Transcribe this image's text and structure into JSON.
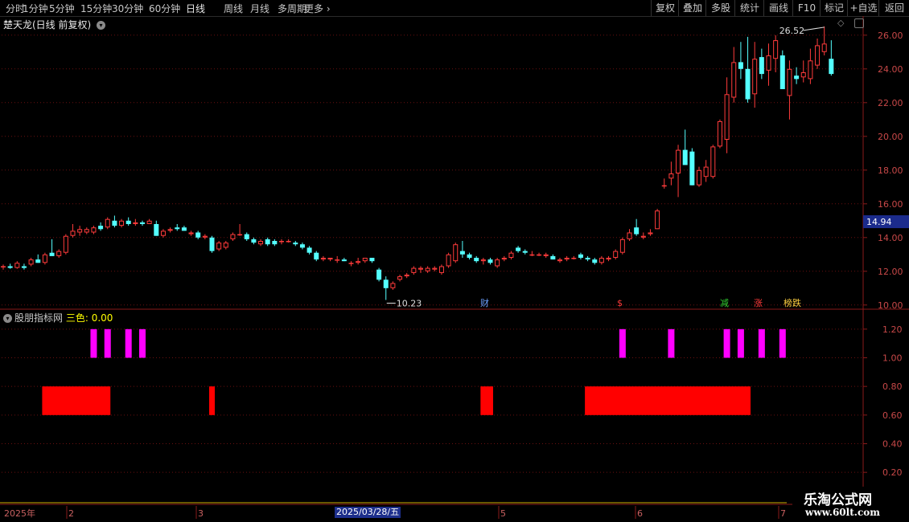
{
  "toolbar": {
    "periods": [
      "分时",
      "1分钟",
      "5分钟",
      "15分钟",
      "30分钟",
      "60分钟",
      "日线",
      "周线",
      "月线",
      "多周期",
      "更多"
    ],
    "active": "日线",
    "right_buttons": [
      "复权",
      "叠加",
      "多股",
      "统计",
      "画线",
      "F10",
      "标记",
      "+自选",
      "返回"
    ]
  },
  "main_panel": {
    "title": "楚天龙(日线 前复权)",
    "high_label": "26.52",
    "low_label": "10.23",
    "current_price": "14.94",
    "y_ticks": [
      "26.00",
      "24.00",
      "22.00",
      "20.00",
      "18.00",
      "16.00",
      "14.00",
      "12.00",
      "10.00"
    ],
    "signals": [
      {
        "text": "财",
        "color": "#6aa0ff"
      },
      {
        "text": "$",
        "color": "#ff3a3a"
      },
      {
        "text": "减",
        "color": "#30d030"
      },
      {
        "text": "涨",
        "color": "#ff3a3a"
      },
      {
        "text": "榜跌",
        "color": "#ffd040"
      }
    ]
  },
  "indicator_panel": {
    "name": "股朋指标网",
    "label": "三色:",
    "value": "0.00",
    "y_ticks": [
      "1.20",
      "1.00",
      "0.80",
      "0.60",
      "0.40",
      "0.20"
    ]
  },
  "x_axis": {
    "year": "2025年",
    "labels": [
      "2",
      "3",
      "5",
      "6",
      "7"
    ],
    "cursor_date": "2025/03/28/五"
  },
  "watermark": {
    "line1": "乐淘公式网",
    "line2": "www.60lt.com"
  },
  "colors": {
    "up": "#ff3b3b",
    "down": "#54ffff",
    "magenta": "#ff00ff",
    "red_block": "#ff0000",
    "grid": "#6a1010"
  },
  "chart_data": [
    {
      "type": "candlestick",
      "ylim": [
        9.8,
        26.8
      ],
      "candles": [
        {
          "o": 12.25,
          "h": 12.4,
          "l": 12.1,
          "c": 12.3
        },
        {
          "o": 12.3,
          "h": 12.45,
          "l": 12.15,
          "c": 12.2
        },
        {
          "o": 12.2,
          "h": 12.6,
          "l": 12.15,
          "c": 12.5
        },
        {
          "o": 12.3,
          "h": 12.45,
          "l": 12.1,
          "c": 12.2
        },
        {
          "o": 12.4,
          "h": 12.8,
          "l": 12.3,
          "c": 12.7
        },
        {
          "o": 12.7,
          "h": 13.0,
          "l": 12.5,
          "c": 12.5
        },
        {
          "o": 12.5,
          "h": 13.1,
          "l": 12.4,
          "c": 13.0
        },
        {
          "o": 13.1,
          "h": 13.9,
          "l": 13.0,
          "c": 12.9
        },
        {
          "o": 12.9,
          "h": 13.3,
          "l": 12.8,
          "c": 13.2
        },
        {
          "o": 13.1,
          "h": 14.2,
          "l": 13.0,
          "c": 14.1
        },
        {
          "o": 14.1,
          "h": 14.8,
          "l": 14.0,
          "c": 14.4
        },
        {
          "o": 14.3,
          "h": 14.7,
          "l": 14.1,
          "c": 14.5
        },
        {
          "o": 14.3,
          "h": 14.6,
          "l": 14.2,
          "c": 14.5
        },
        {
          "o": 14.3,
          "h": 14.7,
          "l": 14.2,
          "c": 14.6
        },
        {
          "o": 14.7,
          "h": 14.9,
          "l": 14.4,
          "c": 14.5
        },
        {
          "o": 14.6,
          "h": 15.2,
          "l": 14.5,
          "c": 15.1
        },
        {
          "o": 15.0,
          "h": 15.3,
          "l": 14.6,
          "c": 14.7
        },
        {
          "o": 14.7,
          "h": 15.1,
          "l": 14.6,
          "c": 15.0
        },
        {
          "o": 15.0,
          "h": 15.2,
          "l": 14.7,
          "c": 14.8
        },
        {
          "o": 14.8,
          "h": 15.1,
          "l": 14.7,
          "c": 14.9
        },
        {
          "o": 14.9,
          "h": 15.0,
          "l": 14.7,
          "c": 14.8
        },
        {
          "o": 14.8,
          "h": 15.1,
          "l": 14.8,
          "c": 15.0
        },
        {
          "o": 14.8,
          "h": 15.0,
          "l": 14.1,
          "c": 14.1
        },
        {
          "o": 14.1,
          "h": 14.5,
          "l": 14.0,
          "c": 14.4
        },
        {
          "o": 14.4,
          "h": 14.6,
          "l": 14.3,
          "c": 14.5
        },
        {
          "o": 14.6,
          "h": 14.8,
          "l": 14.4,
          "c": 14.5
        },
        {
          "o": 14.6,
          "h": 14.7,
          "l": 14.4,
          "c": 14.4
        },
        {
          "o": 14.2,
          "h": 14.4,
          "l": 14.1,
          "c": 14.3
        },
        {
          "o": 14.3,
          "h": 14.4,
          "l": 13.9,
          "c": 14.0
        },
        {
          "o": 14.0,
          "h": 14.2,
          "l": 13.9,
          "c": 14.1
        },
        {
          "o": 14.0,
          "h": 14.1,
          "l": 13.1,
          "c": 13.2
        },
        {
          "o": 13.3,
          "h": 13.8,
          "l": 13.2,
          "c": 13.7
        },
        {
          "o": 13.4,
          "h": 13.8,
          "l": 13.3,
          "c": 13.7
        },
        {
          "o": 13.9,
          "h": 14.3,
          "l": 13.8,
          "c": 14.2
        },
        {
          "o": 14.2,
          "h": 14.8,
          "l": 14.1,
          "c": 14.2
        },
        {
          "o": 14.2,
          "h": 14.3,
          "l": 13.8,
          "c": 13.9
        },
        {
          "o": 13.9,
          "h": 14.0,
          "l": 13.6,
          "c": 13.7
        },
        {
          "o": 13.6,
          "h": 13.9,
          "l": 13.5,
          "c": 13.8
        },
        {
          "o": 13.9,
          "h": 14.0,
          "l": 13.5,
          "c": 13.6
        },
        {
          "o": 13.8,
          "h": 13.9,
          "l": 13.5,
          "c": 13.6
        },
        {
          "o": 13.8,
          "h": 13.9,
          "l": 13.6,
          "c": 13.8
        },
        {
          "o": 13.8,
          "h": 13.9,
          "l": 13.7,
          "c": 13.8
        },
        {
          "o": 13.7,
          "h": 13.8,
          "l": 13.5,
          "c": 13.6
        },
        {
          "o": 13.6,
          "h": 13.7,
          "l": 13.3,
          "c": 13.4
        },
        {
          "o": 13.4,
          "h": 13.5,
          "l": 13.0,
          "c": 13.1
        },
        {
          "o": 13.1,
          "h": 13.2,
          "l": 12.6,
          "c": 12.7
        },
        {
          "o": 12.7,
          "h": 12.9,
          "l": 12.6,
          "c": 12.8
        },
        {
          "o": 12.7,
          "h": 12.8,
          "l": 12.6,
          "c": 12.8
        },
        {
          "o": 12.7,
          "h": 12.9,
          "l": 12.5,
          "c": 12.7
        },
        {
          "o": 12.7,
          "h": 12.8,
          "l": 12.6,
          "c": 12.6
        },
        {
          "o": 12.5,
          "h": 12.6,
          "l": 12.3,
          "c": 12.5
        },
        {
          "o": 12.5,
          "h": 12.8,
          "l": 12.4,
          "c": 12.6
        },
        {
          "o": 12.6,
          "h": 12.8,
          "l": 12.5,
          "c": 12.8
        },
        {
          "o": 12.8,
          "h": 12.8,
          "l": 12.5,
          "c": 12.6
        },
        {
          "o": 12.1,
          "h": 12.2,
          "l": 11.4,
          "c": 11.5
        },
        {
          "o": 11.5,
          "h": 11.7,
          "l": 10.3,
          "c": 11.0
        },
        {
          "o": 11.0,
          "h": 11.4,
          "l": 10.9,
          "c": 11.3
        },
        {
          "o": 11.5,
          "h": 11.8,
          "l": 11.4,
          "c": 11.7
        },
        {
          "o": 11.7,
          "h": 11.9,
          "l": 11.6,
          "c": 11.8
        },
        {
          "o": 11.9,
          "h": 12.3,
          "l": 11.8,
          "c": 12.2
        },
        {
          "o": 12.1,
          "h": 12.3,
          "l": 11.9,
          "c": 12.2
        },
        {
          "o": 12.0,
          "h": 12.3,
          "l": 11.9,
          "c": 12.2
        },
        {
          "o": 12.1,
          "h": 12.3,
          "l": 12.0,
          "c": 12.2
        },
        {
          "o": 11.9,
          "h": 12.4,
          "l": 11.8,
          "c": 12.3
        },
        {
          "o": 12.3,
          "h": 13.1,
          "l": 12.2,
          "c": 13.0
        },
        {
          "o": 12.6,
          "h": 13.7,
          "l": 12.5,
          "c": 13.6
        },
        {
          "o": 13.2,
          "h": 13.8,
          "l": 12.8,
          "c": 13.0
        },
        {
          "o": 13.0,
          "h": 13.1,
          "l": 12.7,
          "c": 12.8
        },
        {
          "o": 12.8,
          "h": 12.9,
          "l": 12.5,
          "c": 12.6
        },
        {
          "o": 12.6,
          "h": 12.8,
          "l": 12.4,
          "c": 12.7
        },
        {
          "o": 12.7,
          "h": 12.8,
          "l": 12.4,
          "c": 12.5
        },
        {
          "o": 12.3,
          "h": 12.8,
          "l": 12.2,
          "c": 12.7
        },
        {
          "o": 12.7,
          "h": 12.9,
          "l": 12.6,
          "c": 12.8
        },
        {
          "o": 12.8,
          "h": 13.2,
          "l": 12.7,
          "c": 13.1
        },
        {
          "o": 13.4,
          "h": 13.5,
          "l": 13.1,
          "c": 13.2
        },
        {
          "o": 13.2,
          "h": 13.3,
          "l": 13.0,
          "c": 13.1
        },
        {
          "o": 13.0,
          "h": 13.2,
          "l": 12.9,
          "c": 13.0
        },
        {
          "o": 13.0,
          "h": 13.1,
          "l": 12.9,
          "c": 13.0
        },
        {
          "o": 12.9,
          "h": 13.1,
          "l": 12.8,
          "c": 13.0
        },
        {
          "o": 12.9,
          "h": 13.0,
          "l": 12.7,
          "c": 12.7
        },
        {
          "o": 12.6,
          "h": 12.8,
          "l": 12.5,
          "c": 12.7
        },
        {
          "o": 12.7,
          "h": 12.9,
          "l": 12.6,
          "c": 12.8
        },
        {
          "o": 12.8,
          "h": 12.9,
          "l": 12.7,
          "c": 12.8
        },
        {
          "o": 13.0,
          "h": 13.1,
          "l": 12.7,
          "c": 12.8
        },
        {
          "o": 12.8,
          "h": 12.9,
          "l": 12.6,
          "c": 12.7
        },
        {
          "o": 12.7,
          "h": 12.8,
          "l": 12.4,
          "c": 12.5
        },
        {
          "o": 12.5,
          "h": 12.9,
          "l": 12.4,
          "c": 12.8
        },
        {
          "o": 12.7,
          "h": 12.9,
          "l": 12.6,
          "c": 12.8
        },
        {
          "o": 12.8,
          "h": 13.3,
          "l": 12.7,
          "c": 13.2
        },
        {
          "o": 13.1,
          "h": 14.0,
          "l": 13.0,
          "c": 13.9
        },
        {
          "o": 13.9,
          "h": 14.5,
          "l": 13.8,
          "c": 14.3
        },
        {
          "o": 14.6,
          "h": 15.1,
          "l": 14.1,
          "c": 14.2
        },
        {
          "o": 14.0,
          "h": 14.3,
          "l": 13.9,
          "c": 14.1
        },
        {
          "o": 14.2,
          "h": 14.5,
          "l": 14.1,
          "c": 14.3
        },
        {
          "o": 14.5,
          "h": 15.7,
          "l": 14.5,
          "c": 15.6
        },
        {
          "o": 17.1,
          "h": 17.5,
          "l": 16.9,
          "c": 17.1
        },
        {
          "o": 17.5,
          "h": 18.5,
          "l": 17.1,
          "c": 17.8
        },
        {
          "o": 17.8,
          "h": 19.5,
          "l": 16.4,
          "c": 19.2
        },
        {
          "o": 19.2,
          "h": 20.4,
          "l": 18.3,
          "c": 18.3
        },
        {
          "o": 19.1,
          "h": 19.3,
          "l": 17.1,
          "c": 17.1
        },
        {
          "o": 17.1,
          "h": 18.2,
          "l": 17.0,
          "c": 18.0
        },
        {
          "o": 17.6,
          "h": 18.6,
          "l": 17.3,
          "c": 18.2
        },
        {
          "o": 17.6,
          "h": 19.5,
          "l": 17.5,
          "c": 19.4
        },
        {
          "o": 19.4,
          "h": 21.0,
          "l": 19.3,
          "c": 20.9
        },
        {
          "o": 19.8,
          "h": 23.5,
          "l": 19.0,
          "c": 22.5
        },
        {
          "o": 22.3,
          "h": 25.3,
          "l": 22.0,
          "c": 24.4
        },
        {
          "o": 24.4,
          "h": 25.6,
          "l": 23.4,
          "c": 24.0
        },
        {
          "o": 24.0,
          "h": 25.9,
          "l": 22.0,
          "c": 22.2
        },
        {
          "o": 22.5,
          "h": 25.6,
          "l": 21.7,
          "c": 24.6
        },
        {
          "o": 24.7,
          "h": 25.2,
          "l": 23.4,
          "c": 23.7
        },
        {
          "o": 23.9,
          "h": 25.5,
          "l": 23.0,
          "c": 24.8
        },
        {
          "o": 24.6,
          "h": 26.0,
          "l": 23.8,
          "c": 25.7
        },
        {
          "o": 24.8,
          "h": 25.1,
          "l": 22.8,
          "c": 22.8
        },
        {
          "o": 22.4,
          "h": 24.5,
          "l": 21.0,
          "c": 24.0
        },
        {
          "o": 23.6,
          "h": 24.1,
          "l": 23.1,
          "c": 23.4
        },
        {
          "o": 23.5,
          "h": 24.5,
          "l": 23.2,
          "c": 23.8
        },
        {
          "o": 23.4,
          "h": 25.2,
          "l": 23.1,
          "c": 24.5
        },
        {
          "o": 24.2,
          "h": 25.8,
          "l": 24.0,
          "c": 25.4
        },
        {
          "o": 25.0,
          "h": 26.52,
          "l": 24.8,
          "c": 25.5
        },
        {
          "o": 24.6,
          "h": 25.7,
          "l": 23.6,
          "c": 23.7
        }
      ]
    },
    {
      "type": "bar",
      "title": "股朋指标网",
      "ylim": [
        0.1,
        1.3
      ],
      "magenta_indices": [
        13,
        15,
        18,
        20,
        89,
        96,
        104,
        106,
        109,
        112
      ],
      "magenta_range": [
        1.0,
        1.2
      ],
      "red_ranges": [
        [
          6,
          15
        ],
        [
          30,
          30
        ],
        [
          69,
          70
        ],
        [
          84,
          107
        ]
      ],
      "red_range": [
        0.6,
        0.8
      ]
    }
  ]
}
